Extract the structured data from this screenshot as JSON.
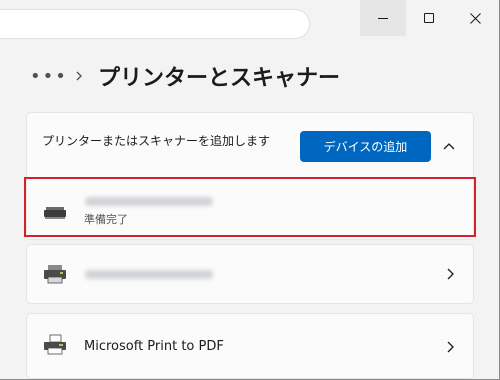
{
  "window": {
    "title_bar": {
      "search_value": ""
    }
  },
  "breadcrumb": {
    "more": "•••",
    "title": "プリンターとスキャナー"
  },
  "add_section": {
    "description": "プリンターまたはスキャナーを追加します",
    "button_label": "デバイスの追加",
    "expanded": true
  },
  "devices": [
    {
      "name": "",
      "status": "準備完了",
      "highlighted": true,
      "icon": "scanner-icon"
    },
    {
      "name": "",
      "status": "",
      "highlighted": false,
      "icon": "printer-icon"
    },
    {
      "name": "Microsoft Print to PDF",
      "status": "",
      "highlighted": false,
      "icon": "pdf-printer-icon"
    }
  ],
  "colors": {
    "accent": "#0067c0",
    "highlight_border": "#d4222b",
    "card_bg": "#fbfbfb",
    "window_bg": "#f3f3f3"
  }
}
